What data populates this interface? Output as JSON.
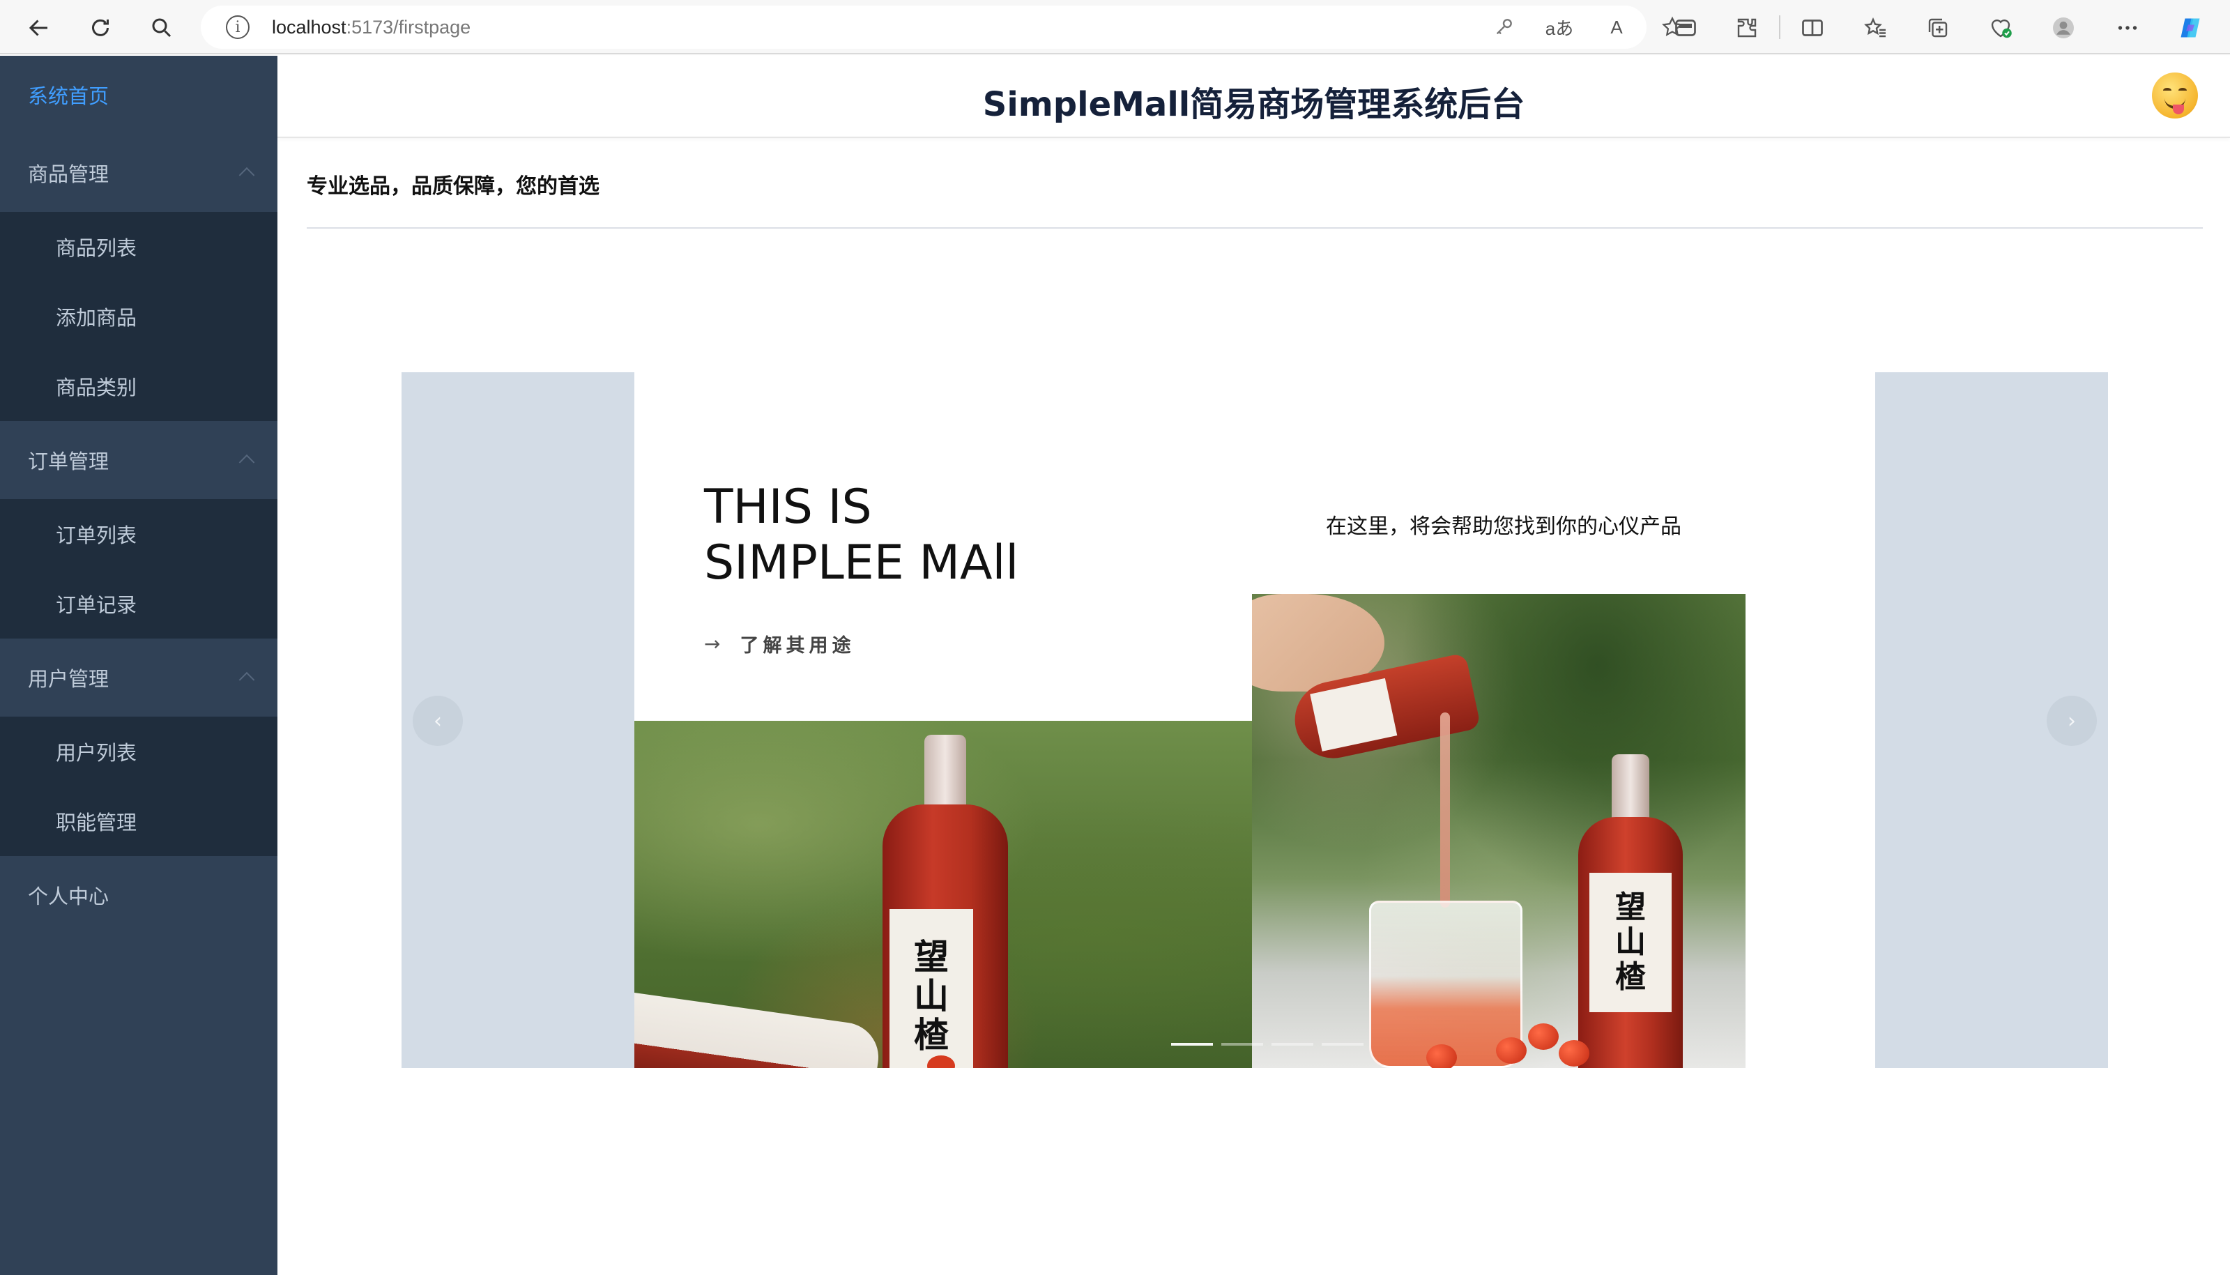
{
  "browser": {
    "url_host": "localhost",
    "url_path": ":5173/firstpage",
    "read_aloud_glyph": "A",
    "translate_glyph": "aあ"
  },
  "sidebar": {
    "items": [
      {
        "label": "系统首页",
        "active": true
      },
      {
        "label": "商品管理",
        "children": [
          "商品列表",
          "添加商品",
          "商品类别"
        ]
      },
      {
        "label": "订单管理",
        "children": [
          "订单列表",
          "订单记录"
        ]
      },
      {
        "label": "用户管理",
        "children": [
          "用户列表",
          "职能管理"
        ]
      },
      {
        "label": "个人中心"
      }
    ]
  },
  "header": {
    "title": "SimpleMall简易商场管理系统后台",
    "avatar_icon": "smiling-face-icon"
  },
  "main": {
    "slogan": "专业选品，品质保障，您的首选"
  },
  "carousel": {
    "hero_title_line1": "THIS IS",
    "hero_title_line2": "SIMPLEE MAll",
    "link_label": "了解其用途",
    "subtitle": "在这里，将会帮助您找到你的心仪产品",
    "bottle_label": [
      "望",
      "山",
      "楂"
    ],
    "indicator_count": 4,
    "active_indicator": 1
  },
  "colors": {
    "sidebar_bg": "#304156",
    "submenu_bg": "#1f2d3d",
    "sidebar_text": "#bfcbd9",
    "active_text": "#409eff",
    "side_card_bg": "#d3dce6"
  }
}
